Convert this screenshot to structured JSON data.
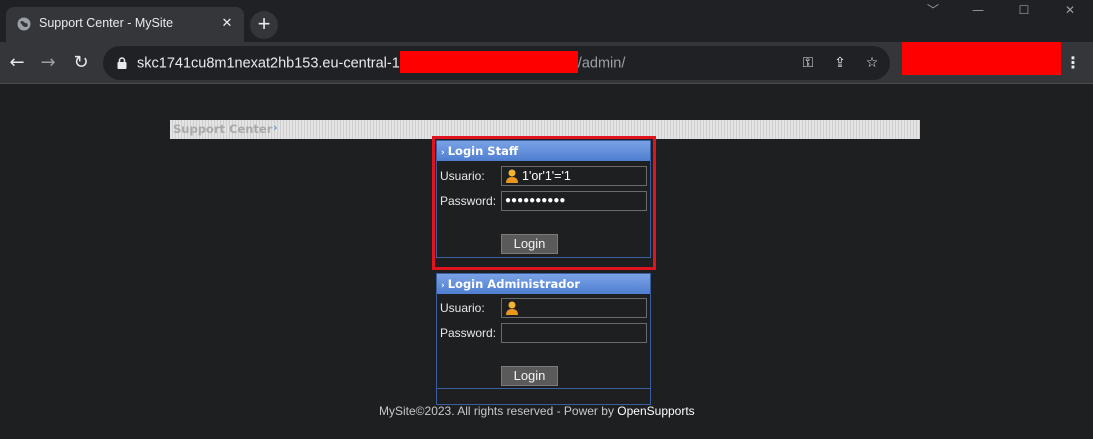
{
  "browser": {
    "tab_title": "Support Center - MySite",
    "url_prefix": "skc1741cu8m1nexat2hb153.eu-central-1",
    "url_suffix": "/admin/",
    "window_controls": {
      "minimize": "—",
      "maximize": "☐",
      "close": "✕"
    }
  },
  "page": {
    "header_label": "Support Center",
    "header_arrow": "›",
    "staff_login": {
      "title": "Login Staff",
      "usuario_label": "Usuario:",
      "usuario_value": "1'or'1'='1",
      "password_label": "Password:",
      "password_value": "●●●●●●●●●●",
      "button": "Login"
    },
    "admin_login": {
      "title": "Login Administrador",
      "usuario_label": "Usuario:",
      "usuario_value": "",
      "password_label": "Password:",
      "password_value": "",
      "button": "Login"
    },
    "footer_text": "MySite©2023. All rights reserved - Power by ",
    "footer_brand": "OpenSupports"
  },
  "colors": {
    "highlight": "#e0141e",
    "redaction": "#ff0000",
    "panel_header": "#5a86d6"
  }
}
